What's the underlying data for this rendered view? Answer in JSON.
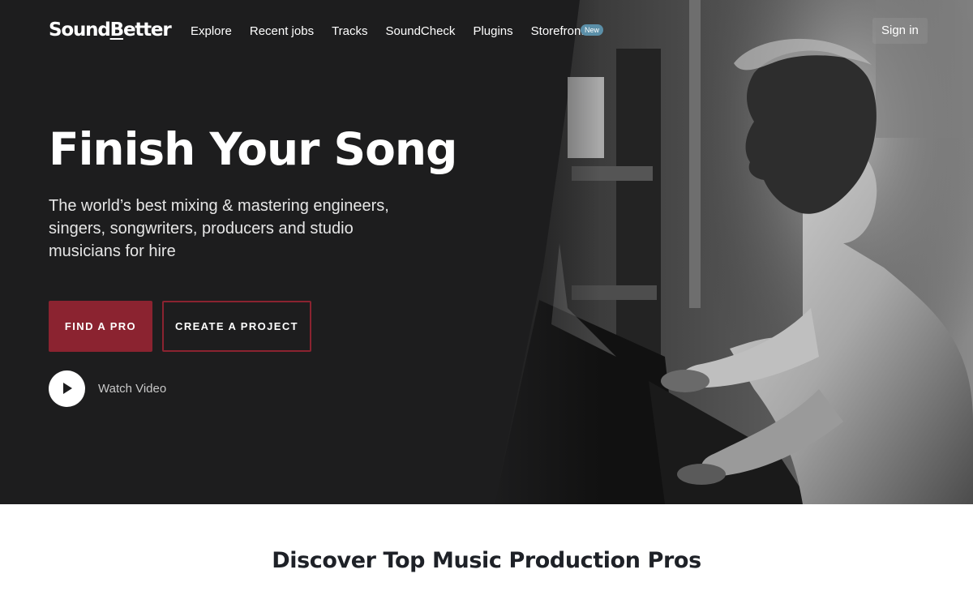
{
  "brand": {
    "logo_prefix": "Sound",
    "logo_under": "B",
    "logo_suffix": "etter"
  },
  "nav": {
    "items": [
      {
        "label": "Explore"
      },
      {
        "label": "Recent jobs"
      },
      {
        "label": "Tracks"
      },
      {
        "label": "SoundCheck"
      },
      {
        "label": "Plugins"
      },
      {
        "label": "Storefront"
      }
    ],
    "new_badge": "New",
    "signin": "Sign in"
  },
  "hero": {
    "title": "Finish Your Song",
    "subtitle": "The world’s best mixing & mastering engineers, singers, songwriters, producers and studio musicians for hire",
    "primary_cta": "FIND A PRO",
    "secondary_cta": "CREATE A PROJECT",
    "watch_video": "Watch Video",
    "play_icon": "play-icon"
  },
  "section": {
    "title": "Discover Top Music Production Pros"
  },
  "colors": {
    "accent": "#8b2330",
    "hero_bg": "#1d1d1e",
    "badge": "#5b8fa8"
  }
}
